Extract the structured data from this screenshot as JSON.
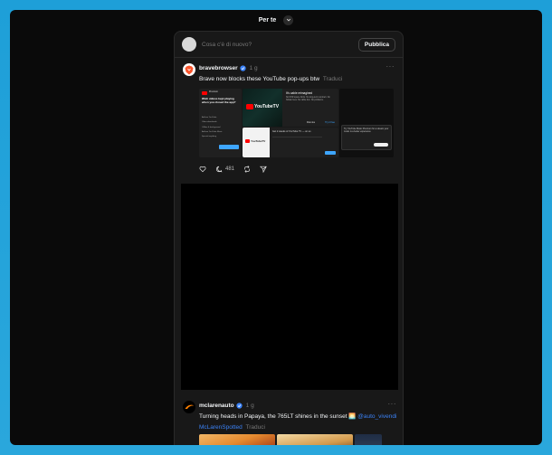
{
  "header": {
    "title": "Per te"
  },
  "composer": {
    "placeholder": "Cosa c'è di nuovo?",
    "publish_label": "Pubblica"
  },
  "posts": [
    {
      "username": "bravebrowser",
      "time": "1 g",
      "text": "Brave now blocks these YouTube pop-ups btw",
      "translate": "Traduci",
      "media": {
        "left_title": "Wish videos kept playing when you closed the app?",
        "left_brand": "Premium",
        "left_items": [
          "Ad-free YouTube",
          "Video downloads",
          "Offline & background",
          "Ad-free YouTube Music",
          "Special anything"
        ],
        "middle_top_heading": "It's cable reimagined",
        "middle_top_brand": "YouTubeTV",
        "middle_top_text": "No DVR space limits. No long-term contract. No hidden fees. No cable box. No problems.",
        "middle_top_dismiss": "Dismiss",
        "middle_top_cta": "Try it free",
        "middle_bottom_brand": "YouTubeTV",
        "middle_bottom_text": "Get 2 weeks of YouTube TV — on us",
        "right_text": "Try YouTube Music Premium for a stream your music is a better experience"
      },
      "replies": "481",
      "colors": {
        "avatar": "#fb542b"
      }
    },
    {
      "username": "mclarenauto",
      "time": "1 g",
      "text": "Turning heads in Papaya, the 765LT shines in the sunset 🌅",
      "mention": "@auto_vivendi",
      "tag": "McLarenSpotted",
      "translate": "Traduci",
      "colors": {
        "avatar": "#ff8000"
      }
    }
  ],
  "colors": {
    "accent": "#3b82f6",
    "background": "#0a0a0a",
    "card": "#181818"
  }
}
